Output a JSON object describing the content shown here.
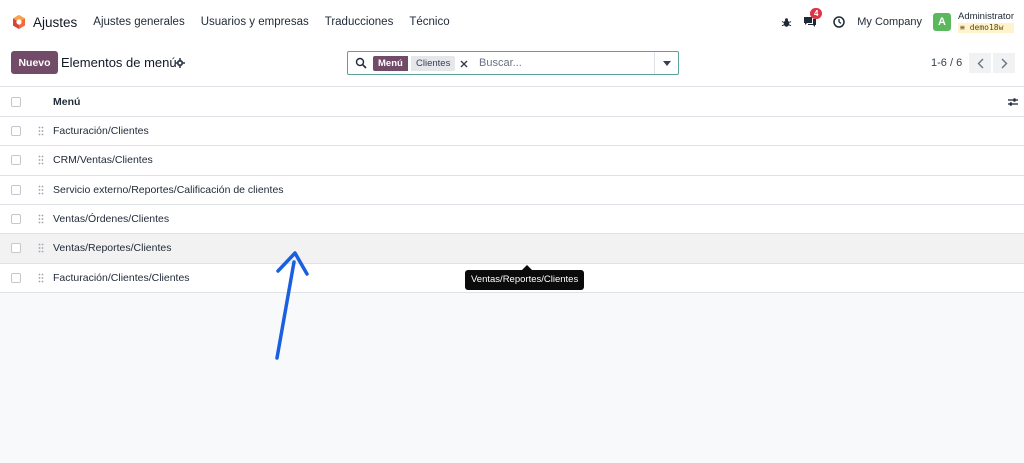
{
  "navbar": {
    "app_name": "Ajustes",
    "menu": [
      "Ajustes generales",
      "Usuarios y empresas",
      "Traducciones",
      "Técnico"
    ],
    "messages_badge": "4",
    "company": "My Company",
    "user_initial": "A",
    "user_name": "Administrator",
    "database": "demo18w"
  },
  "control_panel": {
    "new_button": "Nuevo",
    "title": "Elementos de menú",
    "search": {
      "facet_label": "Menú",
      "facet_value": "Clientes",
      "placeholder": "Buscar..."
    },
    "pager": "1-6 / 6"
  },
  "list": {
    "column_header": "Menú",
    "rows": [
      "Facturación/Clientes",
      "CRM/Ventas/Clientes",
      "Servicio externo/Reportes/Calificación de clientes",
      "Ventas/Órdenes/Clientes",
      "Ventas/Reportes/Clientes",
      "Facturación/Clientes/Clientes"
    ]
  },
  "tooltip": "Ventas/Reportes/Clientes",
  "colors": {
    "brand": "#714b67",
    "badge": "#dc3545",
    "annotation_arrow": "#1a5fe0"
  }
}
